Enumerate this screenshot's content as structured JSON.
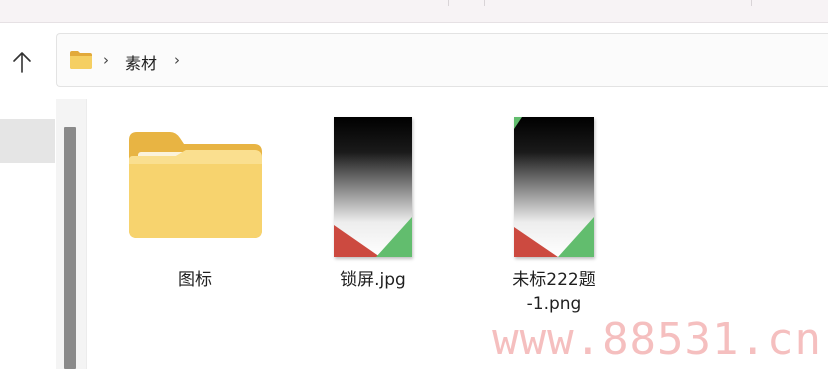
{
  "breadcrumb": {
    "current_folder": "素材",
    "separator": "›"
  },
  "files": [
    {
      "name": "图标",
      "type": "folder",
      "icon": "folder-icon"
    },
    {
      "name": "锁屏.jpg",
      "type": "image",
      "icon": "image-thumbnail"
    },
    {
      "name": "未标222题-1.png",
      "name_line1": "未标222题",
      "name_line2": "-1.png",
      "type": "image",
      "icon": "image-thumbnail"
    }
  ],
  "watermark": "www.88531.cn",
  "colors": {
    "folder_back": "#e9b94a",
    "folder_front": "#f6d675",
    "thumb_red": "#cc4a40",
    "thumb_green": "#62bd6e",
    "scrollbar": "#8a8a8a",
    "watermark": "#f4b5b5"
  }
}
